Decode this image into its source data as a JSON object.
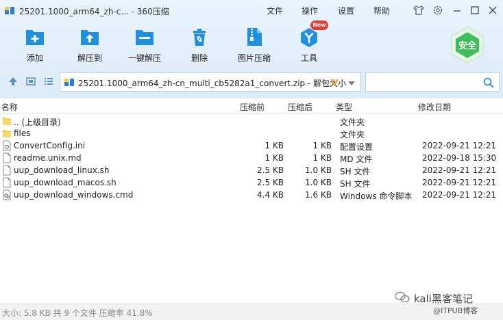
{
  "window": {
    "title": "25201.1000_arm64_zh-c... - 360压缩",
    "menu": [
      "文件",
      "操作",
      "设置",
      "帮助"
    ]
  },
  "toolbar": {
    "items": [
      {
        "label": "添加",
        "icon": "add-icon"
      },
      {
        "label": "解压到",
        "icon": "extract-to-icon"
      },
      {
        "label": "一键解压",
        "icon": "one-click-extract-icon"
      },
      {
        "label": "删除",
        "icon": "delete-icon"
      },
      {
        "label": "图片压缩",
        "icon": "image-compress-icon"
      },
      {
        "label": "工具",
        "icon": "tools-icon"
      }
    ],
    "new_badge": "New",
    "safe_badge": "安全"
  },
  "address": {
    "path": "25201.1000_arm64_zh-cn_multi_cb5282a1_convert.zip - 解包大小"
  },
  "columns": {
    "name": "名称",
    "packed": "压缩前",
    "compressed": "压缩后",
    "type": "类型",
    "modified": "修改日期"
  },
  "files": [
    {
      "name": ".. (上级目录)",
      "packed": "",
      "compressed": "",
      "type": "文件夹",
      "modified": "",
      "kind": "folder"
    },
    {
      "name": "files",
      "packed": "",
      "compressed": "",
      "type": "文件夹",
      "modified": "",
      "kind": "folder"
    },
    {
      "name": "ConvertConfig.ini",
      "packed": "1 KB",
      "compressed": "1 KB",
      "type": "配置设置",
      "modified": "2022-09-21 12:21",
      "kind": "config"
    },
    {
      "name": "readme.unix.md",
      "packed": "1 KB",
      "compressed": "1 KB",
      "type": "MD 文件",
      "modified": "2022-09-18 15:30",
      "kind": "doc"
    },
    {
      "name": "uup_download_linux.sh",
      "packed": "2.5 KB",
      "compressed": "1.0 KB",
      "type": "SH 文件",
      "modified": "2022-09-21 12:21",
      "kind": "doc"
    },
    {
      "name": "uup_download_macos.sh",
      "packed": "2.5 KB",
      "compressed": "1.0 KB",
      "type": "SH 文件",
      "modified": "2022-09-21 12:21",
      "kind": "doc"
    },
    {
      "name": "uup_download_windows.cmd",
      "packed": "4.4 KB",
      "compressed": "1.6 KB",
      "type": "Windows 命令脚本",
      "modified": "2022-09-21 12:21",
      "kind": "cmd"
    }
  ],
  "status": "大小: 5.8 KB 共 9 个文件 压缩率 41.8%",
  "watermark": {
    "line1": "kali黑客笔记",
    "line2": "@ITPUB博客"
  },
  "colors": {
    "toolbar_blue": "#1f8fe0",
    "new_red": "#e53a2f",
    "safe_green": "#3fbf5a",
    "folder_yellow": "#f6c94a"
  }
}
